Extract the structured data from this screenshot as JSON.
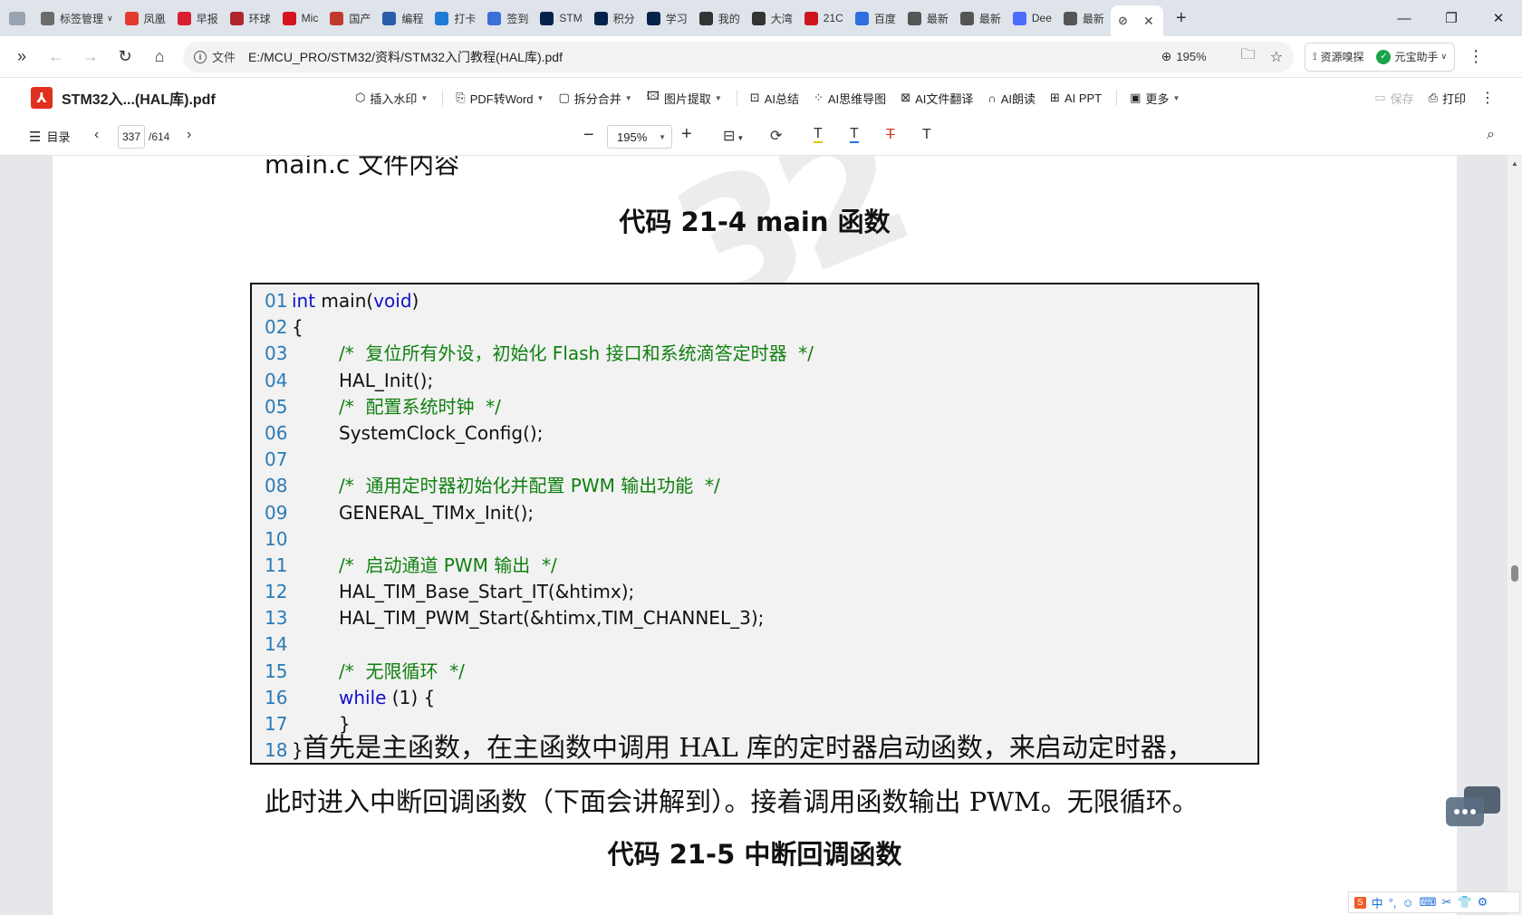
{
  "tabs": [
    {
      "label": "标签管理",
      "fav": "tabs-manager-icon",
      "color": "#6b6b6b"
    },
    {
      "label": "凤凰",
      "fav": "phoenix-icon",
      "color": "#e23b2e"
    },
    {
      "label": "早报",
      "fav": "news-icon",
      "color": "#d81e2f"
    },
    {
      "label": "环球",
      "fav": "globe-news-icon",
      "color": "#b0242d"
    },
    {
      "label": "Mic",
      "fav": "21ic-icon",
      "color": "#d5121f"
    },
    {
      "label": "国产",
      "fav": "e-icon",
      "color": "#c0392b"
    },
    {
      "label": "编程",
      "fav": "code-icon",
      "color": "#2a5caa"
    },
    {
      "label": "打卡",
      "fav": "home-icon",
      "color": "#1f7bd6"
    },
    {
      "label": "签到",
      "fav": "sign-icon",
      "color": "#3a6fd8"
    },
    {
      "label": "STM",
      "fav": "st-logo-icon",
      "color": "#03234b"
    },
    {
      "label": "积分",
      "fav": "st-logo-icon",
      "color": "#03234b"
    },
    {
      "label": "学习",
      "fav": "st-logo-icon",
      "color": "#03234b"
    },
    {
      "label": "我的",
      "fav": "bracket-icon",
      "color": "#333333"
    },
    {
      "label": "大湾",
      "fav": "bracket-icon",
      "color": "#333333"
    },
    {
      "label": "21C",
      "fav": "21ic-red-icon",
      "color": "#d0141e"
    },
    {
      "label": "百度",
      "fav": "translate-icon",
      "color": "#2b6fe0"
    },
    {
      "label": "最新",
      "fav": "link-icon",
      "color": "#555555"
    },
    {
      "label": "最新",
      "fav": "link-icon",
      "color": "#555555"
    },
    {
      "label": "Dee",
      "fav": "deepseek-icon",
      "color": "#4d6bfe"
    },
    {
      "label": "最新",
      "fav": "link-icon",
      "color": "#555555"
    }
  ],
  "active_tab_icon": "link-icon",
  "address": {
    "info_label": "文件",
    "url": "E:/MCU_PRO/STM32/资料/STM32入门教程(HAL库).pdf",
    "zoom": "195%"
  },
  "extensions": {
    "resource": "资源嗅探",
    "assistant": "元宝助手"
  },
  "pdf_toolbar": {
    "title": "STM32入...(HAL库).pdf",
    "watermark": "插入水印",
    "pdf2word": "PDF转Word",
    "split_merge": "拆分合并",
    "image_extract": "图片提取",
    "ai_summary": "AI总结",
    "ai_mindmap": "AI思维导图",
    "ai_translate": "AI文件翻译",
    "ai_read": "AI朗读",
    "ai_ppt": "AI PPT",
    "more": "更多",
    "save": "保存",
    "print": "打印"
  },
  "pdf_toolbar2": {
    "toc": "目录",
    "page_current": "337",
    "page_total": "/614",
    "zoom": "195%"
  },
  "document": {
    "prev_heading": "main.c 文件内容",
    "code_title": "代码 21-4 main 函数",
    "watermark_text": "32",
    "code_lines": [
      {
        "n": "01",
        "parts": [
          {
            "t": "int",
            "c": "kw"
          },
          {
            "t": " main(",
            "c": ""
          },
          {
            "t": "void",
            "c": "kw"
          },
          {
            "t": ")",
            "c": ""
          }
        ],
        "indent": 0
      },
      {
        "n": "02",
        "parts": [
          {
            "t": "{",
            "c": ""
          }
        ],
        "indent": 0
      },
      {
        "n": "03",
        "parts": [
          {
            "t": "/*  复位所有外设，初始化 Flash 接口和系统滴答定时器  */",
            "c": "cm"
          }
        ],
        "indent": 1
      },
      {
        "n": "04",
        "parts": [
          {
            "t": "HAL_Init();",
            "c": ""
          }
        ],
        "indent": 1
      },
      {
        "n": "05",
        "parts": [
          {
            "t": "/*  配置系统时钟  */",
            "c": "cm"
          }
        ],
        "indent": 1
      },
      {
        "n": "06",
        "parts": [
          {
            "t": "SystemClock_Config();",
            "c": ""
          }
        ],
        "indent": 1
      },
      {
        "n": "07",
        "parts": [],
        "indent": 1
      },
      {
        "n": "08",
        "parts": [
          {
            "t": "/*  通用定时器初始化并配置 PWM 输出功能  */",
            "c": "cm"
          }
        ],
        "indent": 1
      },
      {
        "n": "09",
        "parts": [
          {
            "t": "GENERAL_TIMx_Init();",
            "c": ""
          }
        ],
        "indent": 1
      },
      {
        "n": "10",
        "parts": [],
        "indent": 1
      },
      {
        "n": "11",
        "parts": [
          {
            "t": "/*  启动通道 PWM 输出  */",
            "c": "cm"
          }
        ],
        "indent": 1
      },
      {
        "n": "12",
        "parts": [
          {
            "t": "HAL_TIM_Base_Start_IT(&htimx);",
            "c": ""
          }
        ],
        "indent": 1
      },
      {
        "n": "13",
        "parts": [
          {
            "t": "HAL_TIM_PWM_Start(&htimx,TIM_CHANNEL_3);",
            "c": ""
          }
        ],
        "indent": 1
      },
      {
        "n": "14",
        "parts": [],
        "indent": 1
      },
      {
        "n": "15",
        "parts": [
          {
            "t": "/*  无限循环  */",
            "c": "cm"
          }
        ],
        "indent": 1
      },
      {
        "n": "16",
        "parts": [
          {
            "t": "while",
            "c": "kw"
          },
          {
            "t": " (1) {",
            "c": ""
          }
        ],
        "indent": 1
      },
      {
        "n": "17",
        "parts": [
          {
            "t": "}",
            "c": ""
          }
        ],
        "indent": 1
      },
      {
        "n": "18",
        "parts": [
          {
            "t": "}",
            "c": ""
          }
        ],
        "indent": 0
      }
    ],
    "para1": "首先是主函数，在主函数中调用 HAL 库的定时器启动函数，来启动定时器，",
    "para2": "此时进入中断回调函数（下面会讲解到）。接着调用函数输出 PWM。无限循环。",
    "next_heading": "代码 21-5 中断回调函数"
  },
  "ime": {
    "mode": "中"
  },
  "colors": {
    "tabstrip_bg": "#dfe3ea",
    "pdf_logo": "#e0301e",
    "code_keyword": "#1010d0",
    "code_comment": "#108010",
    "line_number": "#2b7bb6"
  }
}
